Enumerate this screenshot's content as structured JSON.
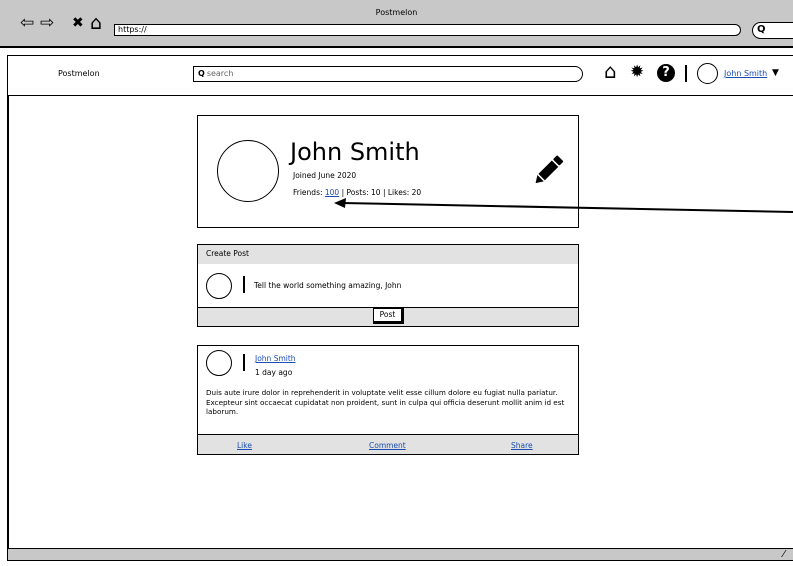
{
  "browser": {
    "title": "Postmelon",
    "url": "https://",
    "search_icon_glyph": "Q",
    "nav": {
      "back": "⇦",
      "forward": "⇨",
      "stop": "✖",
      "home": "⌂"
    }
  },
  "header": {
    "app_name": "Postmelon",
    "search_placeholder": "search",
    "search_glyph": "Q",
    "icons": {
      "home": "⌂",
      "settings": "✹",
      "help": "?"
    },
    "user_name": "John Smith",
    "menu_caret": "▼"
  },
  "profile": {
    "name": "John Smith",
    "joined": "Joined June 2020",
    "stats_prefix": "Friends: ",
    "friends_count": "100",
    "stats_suffix": " | Posts: 10 | Likes: 20"
  },
  "create_post": {
    "header": "Create Post",
    "placeholder": "Tell the world something amazing, John",
    "button": "Post"
  },
  "post": {
    "author": "John Smith",
    "time": "1 day ago",
    "body": "Duis aute irure dolor in reprehenderit in voluptate velit esse cillum dolore eu fugiat nulla pariatur. Excepteur sint occaecat cupidatat non proident, sunt in culpa qui officia deserunt mollit anim id est laborum.",
    "actions": {
      "like": "Like",
      "comment": "Comment",
      "share": "Share"
    }
  },
  "colors": {
    "chrome": "#c8c8c8",
    "panel": "#e2e2e2",
    "link": "#1a4cb3"
  }
}
